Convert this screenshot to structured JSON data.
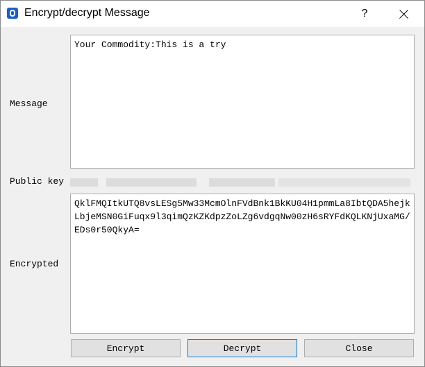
{
  "window": {
    "title": "Encrypt/decrypt Message",
    "help_label": "?",
    "close_label": ""
  },
  "form": {
    "message_label": "Message",
    "message_value": "Your Commodity:This is a try",
    "public_key_label": "Public key",
    "encrypted_label": "Encrypted",
    "encrypted_value": "QklFMQItkUTQ8vsLESg5Mw33McmOlnFVdBnk1BkKU04H1pmmLa8IbtQDA5hejkLbjeMSN0GiFuqx9l3qimQzKZKdpzZoLZg6vdgqNw00zH6sRYFdKQLKNjUxaMG/EDs0r50QkyA="
  },
  "buttons": {
    "encrypt_label": "Encrypt",
    "decrypt_label": "Decrypt",
    "close_label": "Close"
  },
  "icons": {
    "app": "app-logo-icon",
    "close": "close-icon"
  },
  "colors": {
    "accent": "#0078d7",
    "app_icon": "#1a5fc8"
  }
}
